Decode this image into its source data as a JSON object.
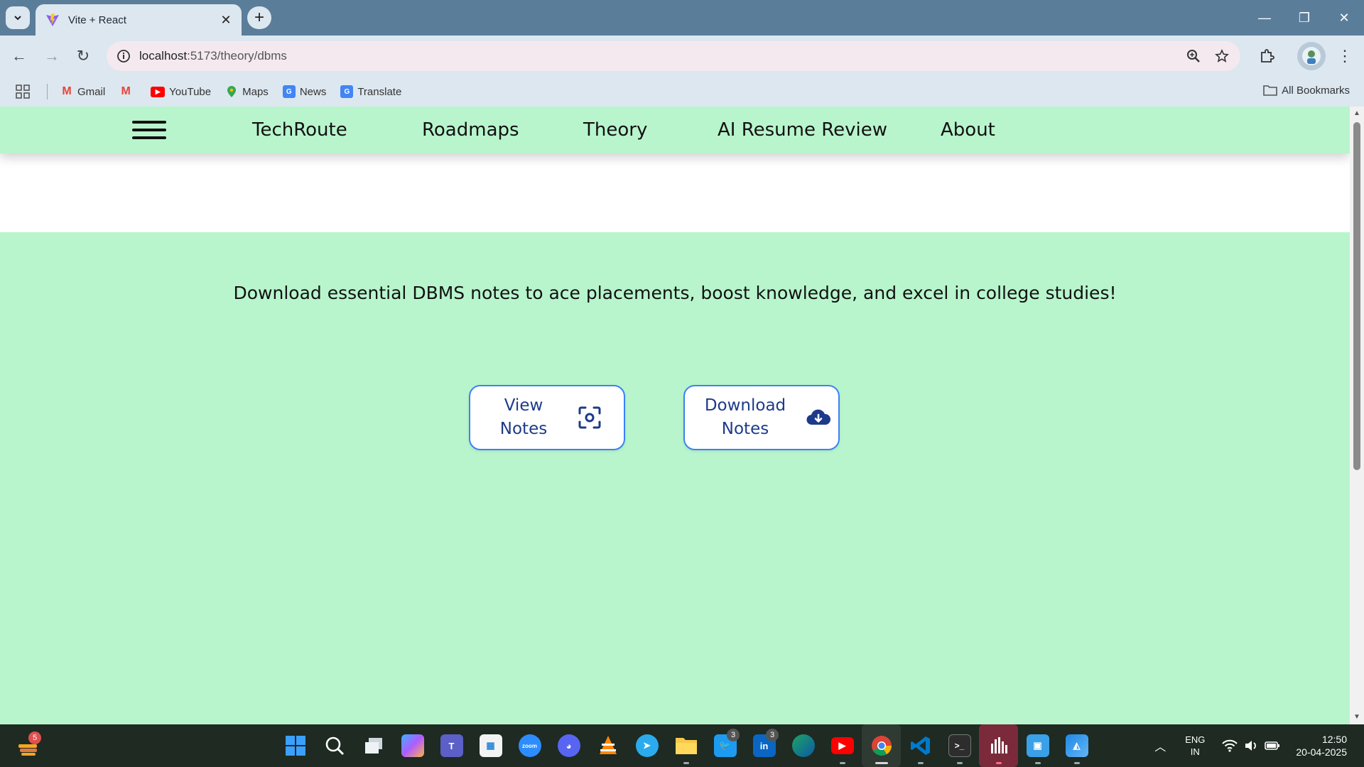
{
  "browser": {
    "tab_title": "Vite + React",
    "url_host": "localhost",
    "url_path": ":5173/theory/dbms",
    "bookmarks": [
      {
        "label": "Gmail",
        "icon": "gmail-icon",
        "color": "#ea4335"
      },
      {
        "label": "",
        "icon": "gmail-icon",
        "color": "#ea4335"
      },
      {
        "label": "YouTube",
        "icon": "youtube-icon",
        "color": "#ff0000"
      },
      {
        "label": "Maps",
        "icon": "maps-icon",
        "color": "#34a853"
      },
      {
        "label": "News",
        "icon": "news-icon",
        "color": "#4285f4"
      },
      {
        "label": "Translate",
        "icon": "translate-icon",
        "color": "#4285f4"
      }
    ],
    "all_bookmarks": "All Bookmarks"
  },
  "page": {
    "nav": {
      "brand": "TechRoute",
      "items": [
        "Roadmaps",
        "Theory",
        "AI Resume Review",
        "About"
      ]
    },
    "headline": "Download essential DBMS notes to ace placements, boost knowledge, and excel in college studies!",
    "buttons": {
      "view": {
        "line1": "View",
        "line2": "Notes",
        "icon": "scan-icon"
      },
      "download": {
        "line1": "Download",
        "line2": "Notes",
        "icon": "cloud-download-icon"
      }
    },
    "colors": {
      "background": "#b8f5cd",
      "button_border": "#3b82f6",
      "button_text": "#1e3a8a"
    }
  },
  "taskbar": {
    "weather_badge": "5",
    "apps": [
      {
        "name": "windows-start-icon",
        "color": "#0078d4",
        "label": "",
        "badge": ""
      },
      {
        "name": "search-icon",
        "color": "transparent",
        "label": "",
        "badge": ""
      },
      {
        "name": "task-view-icon",
        "color": "#9aa",
        "label": "",
        "badge": ""
      },
      {
        "name": "copilot-icon",
        "color": "#7b61ff",
        "label": "",
        "badge": ""
      },
      {
        "name": "teams-icon",
        "color": "#5b5fc7",
        "label": "",
        "badge": ""
      },
      {
        "name": "store-icon",
        "color": "#2b88d8",
        "label": "",
        "badge": ""
      },
      {
        "name": "zoom-icon",
        "color": "#2d8cff",
        "label": "zoom",
        "badge": ""
      },
      {
        "name": "discord-icon",
        "color": "#5865f2",
        "label": "",
        "badge": ""
      },
      {
        "name": "vlc-icon",
        "color": "#ff8800",
        "label": "",
        "badge": ""
      },
      {
        "name": "telegram-icon",
        "color": "#2aabee",
        "label": "",
        "badge": ""
      },
      {
        "name": "file-explorer-icon",
        "color": "#f7c948",
        "label": "",
        "badge": ""
      },
      {
        "name": "twitter-icon",
        "color": "#1d9bf0",
        "label": "",
        "badge": "3"
      },
      {
        "name": "linkedin-icon",
        "color": "#0a66c2",
        "label": "in",
        "badge": "3"
      },
      {
        "name": "edge-icon",
        "color": "#1ea365",
        "label": "",
        "badge": ""
      },
      {
        "name": "youtube-app-icon",
        "color": "#ff0000",
        "label": "",
        "badge": ""
      },
      {
        "name": "chrome-icon",
        "color": "#4285f4",
        "label": "",
        "badge": ""
      },
      {
        "name": "vscode-icon",
        "color": "#007acc",
        "label": "",
        "badge": ""
      },
      {
        "name": "terminal-icon",
        "color": "#2d2d2d",
        "label": "",
        "badge": ""
      },
      {
        "name": "audio-app-icon",
        "color": "#111111",
        "label": "",
        "badge": ""
      },
      {
        "name": "monitor-app-icon",
        "color": "#3aa0e8",
        "label": "",
        "badge": ""
      },
      {
        "name": "photos-icon",
        "color": "#1e88e5",
        "label": "",
        "badge": ""
      }
    ],
    "language_line1": "ENG",
    "language_line2": "IN",
    "time": "12:50",
    "date": "20-04-2025"
  }
}
